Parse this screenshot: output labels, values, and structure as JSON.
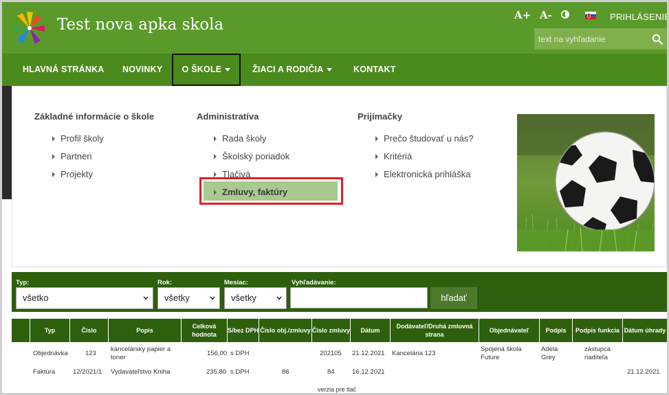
{
  "header": {
    "site_title": "Test nova apka skola",
    "font_increase_label": "A+",
    "font_decrease_label": "A-",
    "login_label": "PRIHLÁSENIE",
    "search_placeholder": "text na vyhľadanie",
    "colors": {
      "header_bg": "#5a9a2a",
      "nav_bg": "#4b8a1c",
      "dark_green": "#2d5f0c",
      "highlight_red": "#e02020"
    }
  },
  "nav": {
    "items": [
      {
        "label": "HLAVNÁ STRÁNKA"
      },
      {
        "label": "NOVINKY"
      },
      {
        "label": "O ŠKOLE",
        "has_dropdown": true,
        "active": true
      },
      {
        "label": "ŽIACI A RODIČIA",
        "has_dropdown": true
      },
      {
        "label": "KONTAKT"
      }
    ]
  },
  "dropdown": {
    "columns": [
      {
        "title": "Základné informácie o škole",
        "items": [
          "Profil školy",
          "Partneri",
          "Projekty"
        ]
      },
      {
        "title": "Administratíva",
        "items": [
          "Rada školy",
          "Školský poriadok",
          "Tlačivá",
          "Zmluvy, faktúry"
        ],
        "highlighted": "Zmluvy, faktúry"
      },
      {
        "title": "Prijímačky",
        "items": [
          "Prečo študovať u nás?",
          "Kritériá",
          "Elektronická prihláška"
        ]
      }
    ]
  },
  "filters": {
    "type_label": "Typ:",
    "type_value": "všetko",
    "year_label": "Rok:",
    "year_value": "všetky",
    "month_label": "Mesiac:",
    "month_value": "všetky",
    "search_label": "Vyhľadávanie:",
    "search_value": "",
    "search_button": "hľadať"
  },
  "table": {
    "columns": [
      "Typ",
      "Číslo",
      "Popis",
      "Celková hodnota",
      "S/bez DPH",
      "Číslo obj./zmluvy",
      "Číslo zmluvy",
      "Dátum",
      "Dodávateľ/Druhá zmluvná strana",
      "Objednávateľ",
      "Podpis",
      "Podpis funkcia",
      "Dátum úhrady"
    ],
    "rows": [
      {
        "typ": "Objednávka",
        "cislo": "123",
        "popis": "kancelársky papier a toner",
        "hodnota": "156,00",
        "dph": "s DPH",
        "obj": "",
        "zmluva": "202105",
        "datum": "21.12.2021",
        "dodavatel": "Kancelária 123",
        "objednavatel": "Spojená škola Future",
        "podpis": "Adela Grey",
        "funkcia": "zástupca riaditeľa",
        "uhrada": ""
      },
      {
        "typ": "Faktúra",
        "cislo": "12/2021/1",
        "popis": "Vydavateľstvo Kniha",
        "hodnota": "235,80",
        "dph": "s DPH",
        "obj": "86",
        "zmluva": "84",
        "datum": "16.12.2021",
        "dodavatel": "",
        "objednavatel": "",
        "podpis": "",
        "funkcia": "",
        "uhrada": "21.12.2021"
      }
    ],
    "print_label": "verzia pre tlač"
  }
}
